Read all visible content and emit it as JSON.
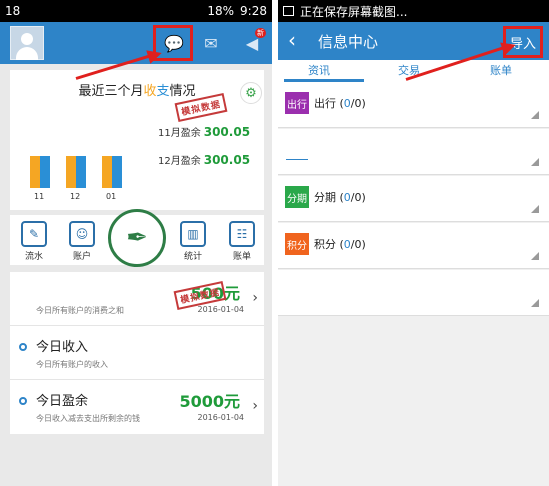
{
  "left": {
    "status": {
      "left": "18",
      "battery": "18%",
      "time": "9:28"
    },
    "header": {
      "chat_icon": "chat-bubble-icon",
      "mail_icon": "envelope-icon",
      "notify_icon": "bell-icon",
      "notify_badge": "新"
    },
    "chart_card": {
      "title_pre": "最近三个月",
      "title_in": "收",
      "title_out": "支",
      "title_post": "情况",
      "stamp": "模拟数据",
      "nov_label": "11月盈余",
      "nov_value": "300.05",
      "dec_label": "12月盈余",
      "dec_value": "300.05"
    },
    "chart_data": {
      "type": "bar",
      "categories": [
        "11",
        "12",
        "01"
      ],
      "series": [
        {
          "values": [
            1,
            1,
            1
          ],
          "color": "#f5a623"
        },
        {
          "values": [
            1,
            1,
            1
          ],
          "color": "#2a8fd6"
        }
      ]
    },
    "tools": [
      {
        "label": "流水",
        "icon": "pen-note-icon"
      },
      {
        "label": "账户",
        "icon": "account-icon"
      },
      {
        "label": "",
        "icon": "fountain-pen-icon"
      },
      {
        "label": "统计",
        "icon": "chart-icon"
      },
      {
        "label": "账单",
        "icon": "bill-icon"
      }
    ],
    "summary": [
      {
        "title": "",
        "sub": "今日所有账户的消费之和",
        "value": "500元",
        "date": "2016-01-04",
        "color": "#1f9b3a"
      },
      {
        "title": "今日收入",
        "sub": "今日所有账户的收入",
        "value": "",
        "date": "",
        "color": "#1f9b3a"
      },
      {
        "title": "今日盈余",
        "sub": "今日收入减去支出所剩余的钱",
        "value": "5000元",
        "date": "2016-01-04",
        "color": "#1f9b3a"
      }
    ],
    "summary_stamp": "模拟数据"
  },
  "right": {
    "status": {
      "text": "正在保存屏幕截图..."
    },
    "header": {
      "title": "信息中心",
      "import_label": "导入",
      "back_icon": "back-chevron-icon"
    },
    "tabs": [
      "资讯",
      "交易",
      "账单"
    ],
    "messages": [
      {
        "chip": "出行",
        "chip_color": "#9b2fae",
        "title": "出行",
        "count_read": "0",
        "count_total": "0"
      },
      {
        "chip": "",
        "chip_color": "",
        "title": "",
        "count_read": "",
        "count_total": ""
      },
      {
        "chip": "分期",
        "chip_color": "#2aa84a",
        "title": "分期",
        "count_read": "0",
        "count_total": "0"
      },
      {
        "chip": "积分",
        "chip_color": "#f0641e",
        "title": "积分",
        "count_read": "0",
        "count_total": "0"
      },
      {
        "chip": "",
        "chip_color": "",
        "title": "",
        "count_read": "",
        "count_total": ""
      }
    ]
  }
}
